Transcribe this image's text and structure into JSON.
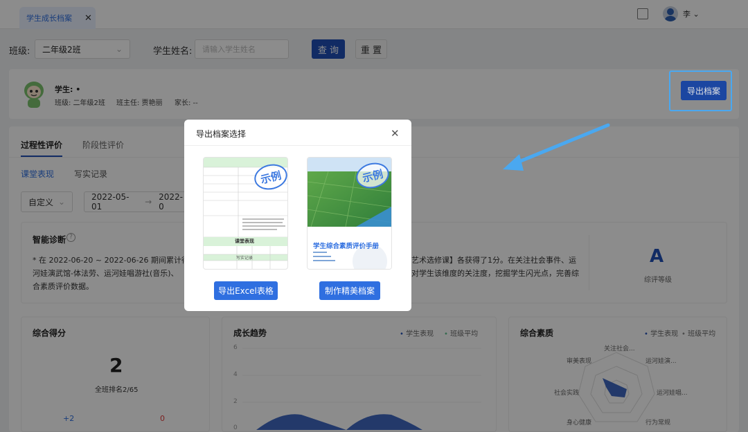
{
  "header": {
    "tab_label": "学生成长档案",
    "tab_close": "✕",
    "user_name": "李"
  },
  "filters": {
    "class_label": "班级:",
    "class_value": "二年级2班",
    "name_label": "学生姓名:",
    "name_placeholder": "请输入学生姓名",
    "query_button": "查 询",
    "reset_button": "重 置"
  },
  "student": {
    "name_label": "学生: •",
    "class_info": "班级: 二年级2班",
    "teacher_info": "班主任: 贾艳丽",
    "parent_info": "家长: --",
    "export_button": "导出档案"
  },
  "tabs": {
    "process": "过程性评价",
    "stage": "阶段性评价",
    "sub_class": "课堂表现",
    "sub_record": "写实记录"
  },
  "date_filter": {
    "mode": "自定义",
    "start": "2022-05-01",
    "arrow": "→",
    "end": "2022-0"
  },
  "diagnosis": {
    "title": "智能诊断",
    "text_line1_left": "* 在 2022-06-20 ~ 2022-06-26 期间累计得",
    "text_line1_right": "艺术选修课】各获得了1分。在关注社会事件、运",
    "text_line2_left": "河娃演武馆-体法劳、运河娃唱游社(音乐)、",
    "text_line2_right": "对学生该维度的关注度，挖掘学生闪光点，完善综",
    "text_line3": "合素质评价数据。",
    "grade": "A",
    "grade_label": "综评等级"
  },
  "score_panel": {
    "title": "综合得分",
    "score": "2",
    "rank": "全班排名2/65",
    "left_value": "+2",
    "right_value": "0"
  },
  "trend_panel": {
    "title": "成长趋势",
    "legend_student": "学生表现",
    "legend_class": "班级平均",
    "y_ticks": [
      "6",
      "4",
      "2",
      "0"
    ]
  },
  "quality_panel": {
    "title": "综合素质",
    "legend_student": "学生表现",
    "legend_class": "班级平均",
    "axes": [
      "关注社会...",
      "运河娃演...",
      "运河娃唱...",
      "行为常规",
      "身心健康",
      "社会实践",
      "审美表现"
    ]
  },
  "modal": {
    "title": "导出档案选择",
    "close": "✕",
    "stamp_text": "示例",
    "excel_button": "导出Excel表格",
    "fine_button": "制作精美档案",
    "booklet_title": "学生综合素质评价手册",
    "doc_section": "课堂表现",
    "doc_section2": "写实记录"
  },
  "colors": {
    "primary": "#1f4fb6",
    "modal_button": "#2f6fe0",
    "highlight": "#4aa8f0",
    "grade": "#1f4fb6"
  }
}
